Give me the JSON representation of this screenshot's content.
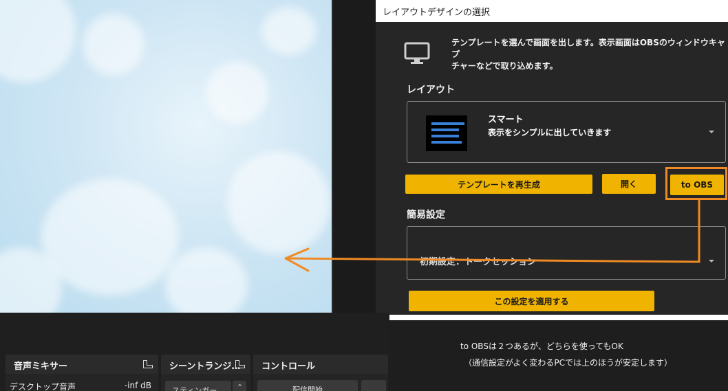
{
  "dialog": {
    "title": "レイアウトデザインの選択",
    "intro_line1": "テンプレートを選んで画面を出します。表示画面はOBSのウィンドウキャプ",
    "intro_line2": "チャーなどで取り込めます。",
    "layout_label": "レイアウト",
    "layout_select": {
      "name": "スマート",
      "description": "表示をシンプルに出していきます"
    },
    "buttons": {
      "regenerate": "テンプレートを再生成",
      "open": "開く",
      "to_obs": "to OBS",
      "apply": "この設定を適用する"
    },
    "simple_settings_label": "簡易設定",
    "simple_settings_value": "初期設定：トークセッション",
    "icons": [
      "monitor-icon",
      "chevron-down-icon"
    ],
    "colors": {
      "accent": "#f0b400",
      "highlight": "#f08a24",
      "background": "#262626"
    }
  },
  "docks": {
    "mixer": {
      "title": "音声ミキサー",
      "source": "デスクトップ音声",
      "level": "-inf dB"
    },
    "transition": {
      "title": "シーントランジ…",
      "value": "スティンガー"
    },
    "controls": {
      "title": "コントロール",
      "button": "配信開始"
    }
  },
  "note": {
    "line1": "to OBSは２つあるが、どちらを使ってもOK",
    "line2": "（通信設定がよく変わるPCでは上のほうが安定します）"
  }
}
